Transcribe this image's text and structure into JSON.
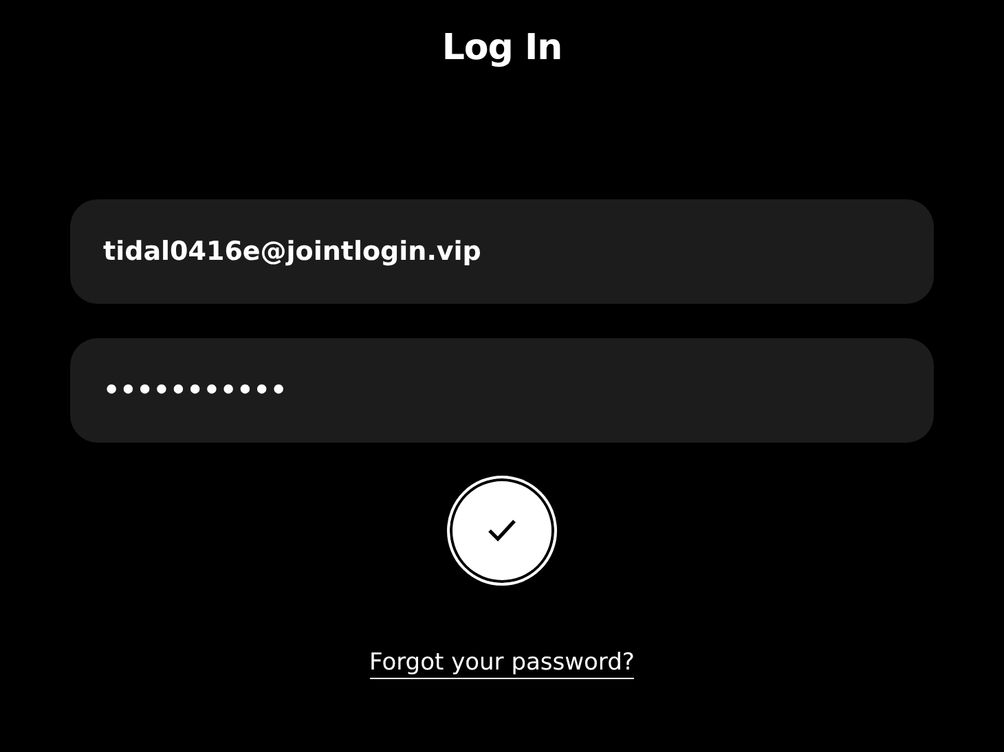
{
  "title": "Log In",
  "email_field": {
    "value": "tidal0416e@jointlogin.vip"
  },
  "password_field": {
    "value": "•••••••••••"
  },
  "forgot_link": "Forgot your password?"
}
